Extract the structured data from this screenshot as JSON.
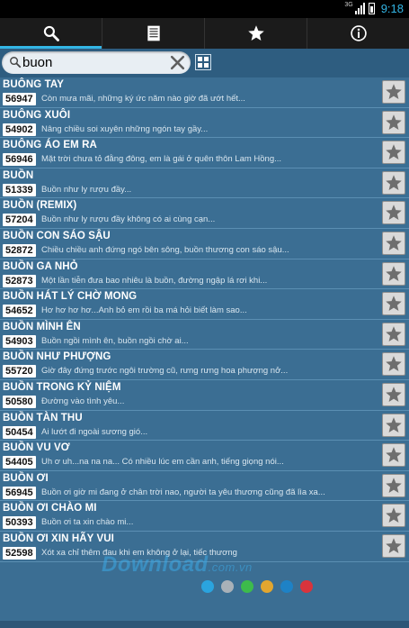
{
  "status_bar": {
    "network": "3G",
    "time": "9:18"
  },
  "tabs": [
    {
      "name": "search",
      "icon": "search-icon",
      "active": true
    },
    {
      "name": "list",
      "icon": "list-icon",
      "active": false
    },
    {
      "name": "favorites",
      "icon": "star-icon",
      "active": false
    },
    {
      "name": "info",
      "icon": "info-icon",
      "active": false
    }
  ],
  "search": {
    "value": "buon",
    "placeholder": ""
  },
  "songs": [
    {
      "title": "BUÔNG TAY",
      "code": "56947",
      "snippet": "Còn mưa mãi, những ký ức năm nào giờ đã ướt hết..."
    },
    {
      "title": "BUÔNG XUÔI",
      "code": "54902",
      "snippet": "Nâng chiều soi xuyên những ngón tay gầy..."
    },
    {
      "title": "BUÔNG ÁO EM RA",
      "code": "56946",
      "snippet": "Mặt trời chưa tỏ đằng đông, em là gái ở quên thôn Lam Hồng..."
    },
    {
      "title": "BUỒN",
      "code": "51339",
      "snippet": "Buồn như ly rượu đầy..."
    },
    {
      "title": "BUỒN (REMIX)",
      "code": "57204",
      "snippet": "Buồn như ly rượu đầy không có ai cùng cạn..."
    },
    {
      "title": "BUỒN CON SÁO SẬU",
      "code": "52872",
      "snippet": "Chiều chiều anh đứng ngó bên sông, buồn thương con sáo sậu..."
    },
    {
      "title": "BUỒN GA NHỎ",
      "code": "52873",
      "snippet": "Một lần tiễn đưa bao nhiêu là buồn, đường ngập lá rơi khi..."
    },
    {
      "title": "BUỒN HÁT LÝ CHỜ MONG",
      "code": "54652",
      "snippet": "Hơ hơ hơ hơ...Anh bỏ em rồi ba má hỏi biết làm sao..."
    },
    {
      "title": "BUỒN MÌNH ÊN",
      "code": "54903",
      "snippet": "Buồn ngồi mình ên, buồn ngồi chờ ai..."
    },
    {
      "title": "BUỒN NHƯ PHƯỢNG",
      "code": "55720",
      "snippet": "Giờ đây đứng trước ngôi trường cũ, rưng rưng hoa phượng nở..."
    },
    {
      "title": "BUỒN TRONG KỶ NIỆM",
      "code": "50580",
      "snippet": "Đường vào tình yêu..."
    },
    {
      "title": "BUỒN TÀN THU",
      "code": "50454",
      "snippet": "Ai lướt đi ngoài sương gió..."
    },
    {
      "title": "BUỒN VU VƠ",
      "code": "54405",
      "snippet": "Uh ơ uh...na na na... Có nhiều lúc em cần anh, tiếng giọng nói..."
    },
    {
      "title": "BUỒN ƠI",
      "code": "56945",
      "snippet": "Buồn ơi giờ mi đang ở chân trời nao, người ta yêu thương cũng đã lìa xa..."
    },
    {
      "title": "BUỒN ƠI CHÀO MI",
      "code": "50393",
      "snippet": "Buồn ơi ta xin chào mi..."
    },
    {
      "title": "BUỒN ƠI XIN HÃY VUI",
      "code": "52598",
      "snippet": "Xót xa chỉ thêm đau khi em không ở lại, tiếc thương"
    }
  ],
  "watermark": {
    "main": "Download",
    "suffix": ".com.vn"
  },
  "color_dots": [
    "#2aa4df",
    "#a9b1b8",
    "#3dbb4c",
    "#e2a62f",
    "#1e82c6",
    "#d9343c"
  ],
  "colors": {
    "accent": "#33b5e5",
    "background": "#3b6e93"
  }
}
